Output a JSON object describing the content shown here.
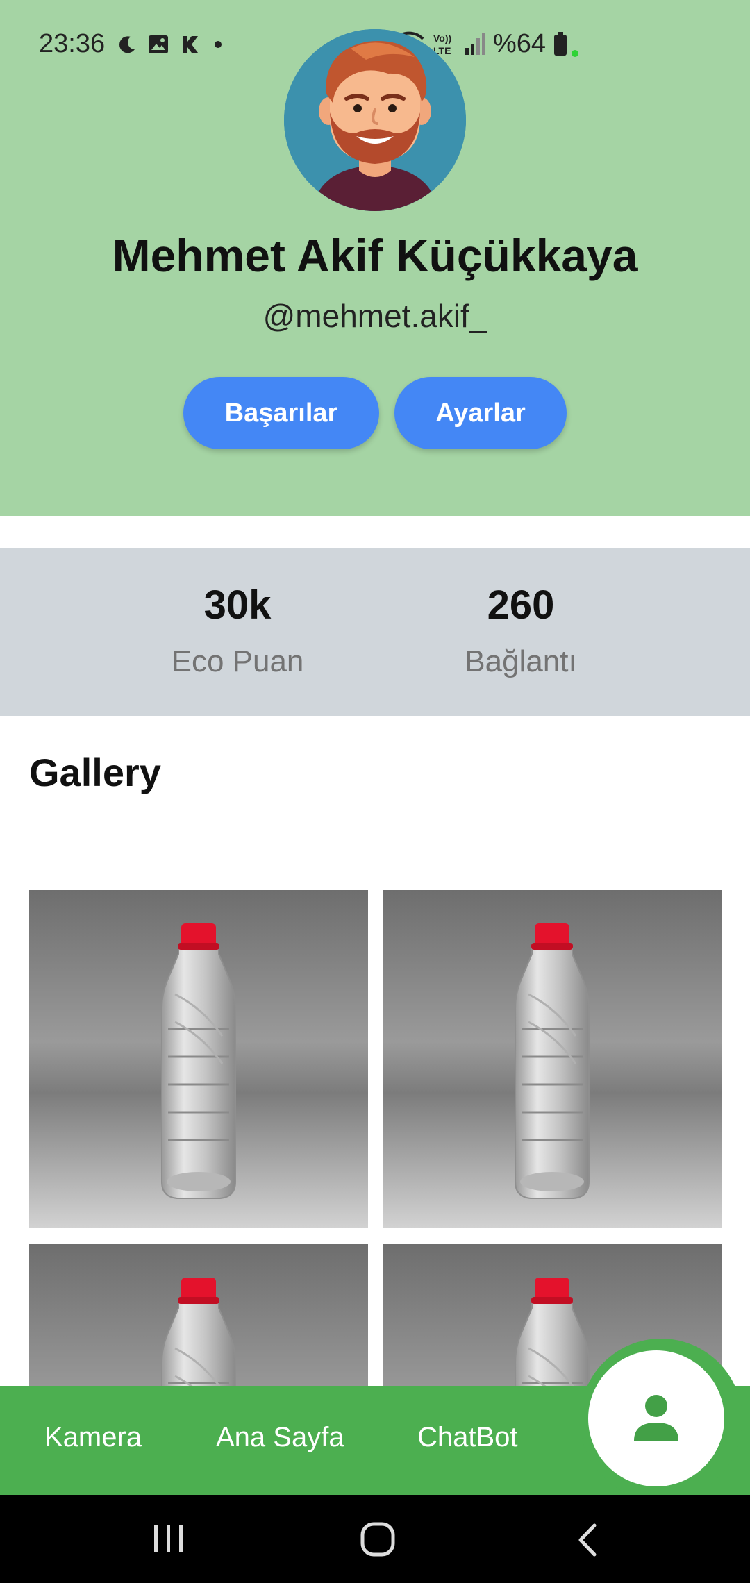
{
  "status_bar": {
    "time": "23:36",
    "battery": "%64"
  },
  "profile": {
    "name": "Mehmet Akif Küçükkaya",
    "handle": "@mehmet.akif_",
    "buttons": {
      "achievements": "Başarılar",
      "settings": "Ayarlar"
    }
  },
  "stats": [
    {
      "value": "30k",
      "label": "Eco Puan"
    },
    {
      "value": "260",
      "label": "Bağlantı"
    }
  ],
  "gallery": {
    "title": "Gallery"
  },
  "bottom_nav": {
    "items": [
      "Kamera",
      "Ana Sayfa",
      "ChatBot"
    ],
    "active": "profile-icon"
  },
  "colors": {
    "header_bg": "#a5d4a4",
    "button_blue": "#4487f5",
    "stats_bg": "#d0d6db",
    "nav_green": "#4caf50"
  }
}
